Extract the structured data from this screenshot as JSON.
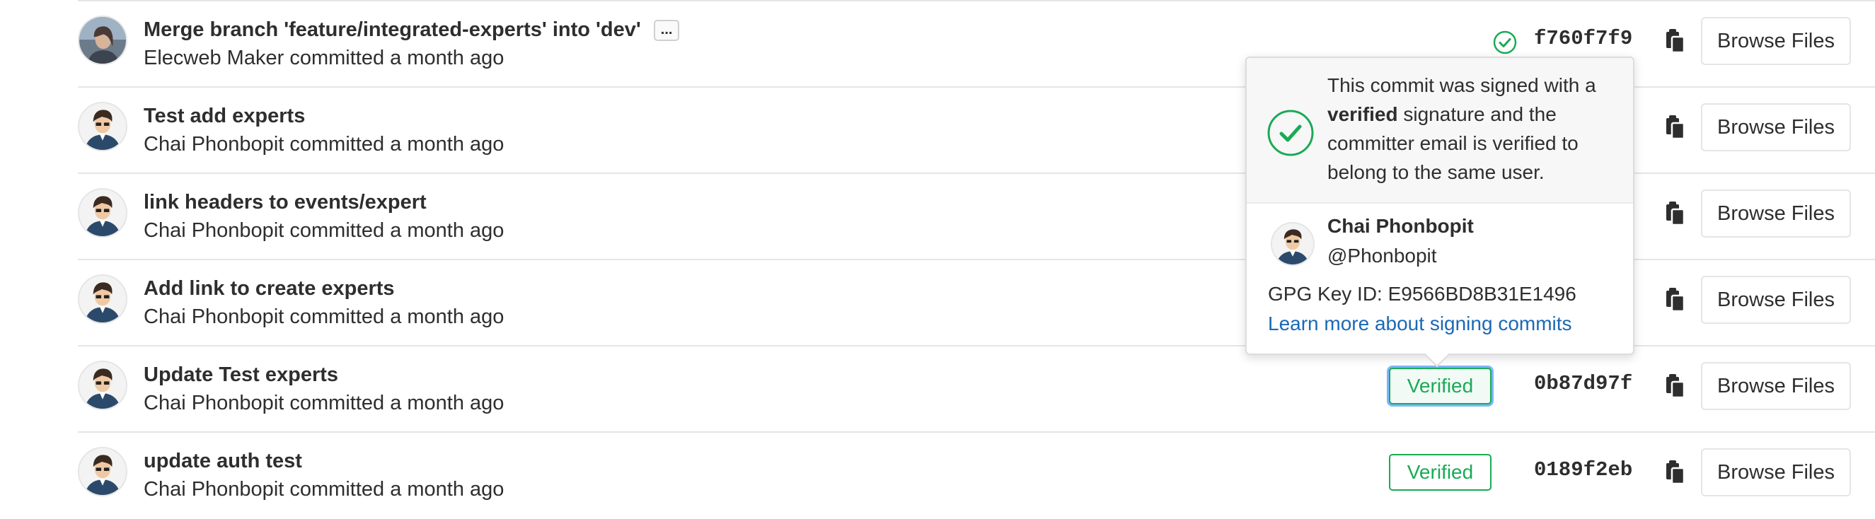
{
  "commits": [
    {
      "title": "Merge branch 'feature/integrated-experts' into 'dev'",
      "has_ellipsis": true,
      "ellipsis_label": "...",
      "author": "Elecweb Maker",
      "meta": "committed a month ago",
      "signature": "icon",
      "sha": "f760f7f9",
      "browse_label": "Browse Files"
    },
    {
      "title": "Test add experts",
      "author": "Chai Phonbopit",
      "meta": "committed a month ago",
      "signature": "hidden",
      "sha": "",
      "browse_label": "Browse Files"
    },
    {
      "title": "link headers to events/expert",
      "author": "Chai Phonbopit",
      "meta": "committed a month ago",
      "signature": "hidden",
      "sha": "",
      "browse_label": "Browse Files"
    },
    {
      "title": "Add link to create experts",
      "author": "Chai Phonbopit",
      "meta": "committed a month ago",
      "signature": "hidden",
      "sha": "",
      "browse_label": "Browse Files"
    },
    {
      "title": "Update Test experts",
      "author": "Chai Phonbopit",
      "meta": "committed a month ago",
      "signature": "badge-active",
      "badge_label": "Verified",
      "sha": "0b87d97f",
      "browse_label": "Browse Files"
    },
    {
      "title": "update auth test",
      "author": "Chai Phonbopit",
      "meta": "committed a month ago",
      "signature": "badge",
      "badge_label": "Verified",
      "sha": "0189f2eb",
      "browse_label": "Browse Files"
    }
  ],
  "popover": {
    "text_before": "This commit was signed with a ",
    "text_bold": "verified",
    "text_after": " signature and the committer email is verified to belong to the same user.",
    "name": "Chai Phonbopit",
    "username": "@Phonbopit",
    "gpg_key": "GPG Key ID: E9566BD8B31E1496",
    "learn_more": "Learn more about signing commits"
  },
  "colors": {
    "verified_green": "#1aaa55",
    "link_blue": "#1b69b6",
    "border": "#e5e5e5"
  },
  "icons": {
    "signature_icon": "check-circle-icon",
    "copy_icon": "clipboard-icon",
    "popover_icon": "check-circle-icon"
  }
}
